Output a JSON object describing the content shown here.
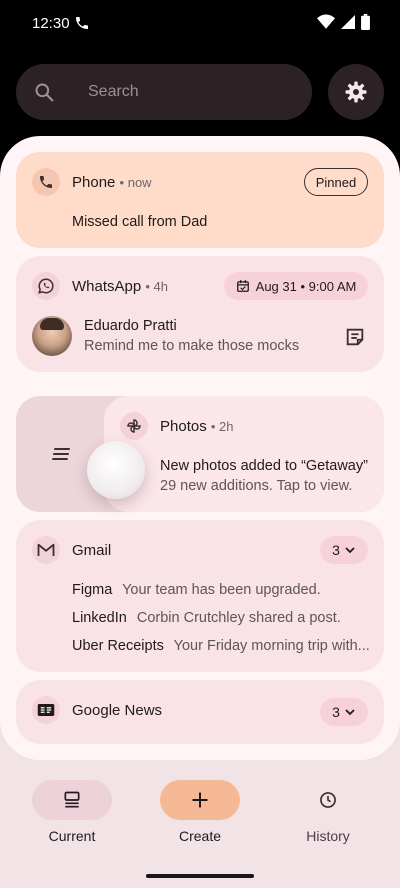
{
  "status_bar": {
    "time": "12:30"
  },
  "search": {
    "placeholder": "Search"
  },
  "notifications": {
    "phone": {
      "app": "Phone",
      "age": "now",
      "badge": "Pinned",
      "text": "Missed call from Dad"
    },
    "whatsapp": {
      "app": "WhatsApp",
      "age": "4h",
      "reminder": "Aug 31 • 9:00 AM",
      "sender": "Eduardo Pratti",
      "message": "Remind me to make those mocks"
    },
    "photos": {
      "app": "Photos",
      "age": "2h",
      "title": "New photos added to “Getaway”",
      "text": "29 new additions. Tap to view."
    },
    "gmail": {
      "app": "Gmail",
      "count": "3",
      "messages": [
        {
          "from": "Figma",
          "subject": "Your team has been upgraded."
        },
        {
          "from": "LinkedIn",
          "subject": "Corbin Crutchley shared a post."
        },
        {
          "from": "Uber Receipts",
          "subject": "Your Friday morning trip with..."
        }
      ]
    },
    "news": {
      "app": "Google News",
      "count": "3"
    }
  },
  "nav": {
    "current": "Current",
    "create": "Create",
    "history": "History"
  },
  "colors": {
    "accent_peach": "#ffdbca",
    "card_pink": "#f9e3e7",
    "create_button": "#f4b994"
  }
}
